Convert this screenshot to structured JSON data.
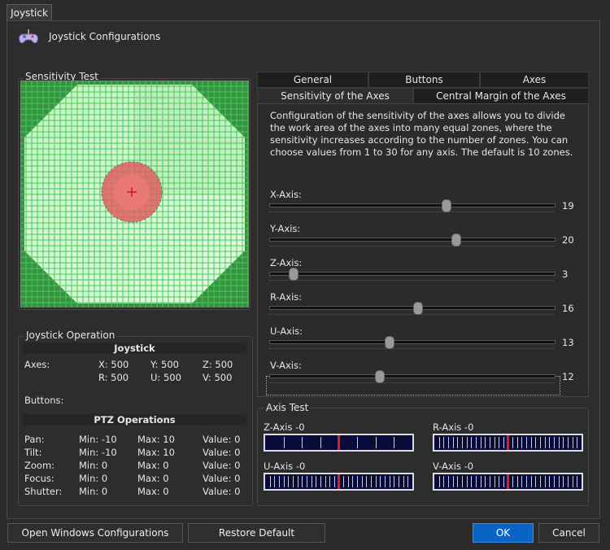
{
  "tab_title": "Joystick",
  "dialog_title": "Joystick Configurations",
  "sensitivity_test_label": "Sensitivity Test",
  "tabs": {
    "row1": [
      "General",
      "Buttons",
      "Axes"
    ],
    "row2": [
      "Sensitivity of the Axes",
      "Central Margin of the Axes"
    ],
    "active": "Sensitivity of the Axes"
  },
  "description": "Configuration of the sensitivity of the axes allows you to divide the work area of the axes into many equal zones, where the sensitivity increases according to the number of zones. You can choose values from 1 to 30 for any axis. The default is 10 zones.",
  "sliders": [
    {
      "label": "X-Axis:",
      "value": "19"
    },
    {
      "label": "Y-Axis:",
      "value": "20"
    },
    {
      "label": "Z-Axis:",
      "value": "3"
    },
    {
      "label": "R-Axis:",
      "value": "16"
    },
    {
      "label": "U-Axis:",
      "value": "13"
    },
    {
      "label": "V-Axis:",
      "value": "12"
    }
  ],
  "joystick_operation": {
    "legend": "Joystick Operation",
    "header": "Joystick",
    "axes_label": "Axes:",
    "axes": [
      "X: 500",
      "Y: 500",
      "Z: 500",
      "R: 500",
      "U: 500",
      "V: 500"
    ],
    "buttons_label": "Buttons:",
    "ptz_header": "PTZ Operations",
    "ptz_rows": [
      {
        "name": "Pan:",
        "min": "Min: -10",
        "max": "Max: 10",
        "value": "Value: 0"
      },
      {
        "name": "Tilt:",
        "min": "Min: -10",
        "max": "Max: 10",
        "value": "Value: 0"
      },
      {
        "name": "Zoom:",
        "min": "Min: 0",
        "max": "Max: 0",
        "value": "Value: 0"
      },
      {
        "name": "Focus:",
        "min": "Min: 0",
        "max": "Max: 0",
        "value": "Value: 0"
      },
      {
        "name": "Shutter:",
        "min": "Min: 0",
        "max": "Max: 0",
        "value": "Value: 0"
      }
    ]
  },
  "axis_test": {
    "legend": "Axis Test",
    "items": [
      {
        "label": "Z-Axis -0"
      },
      {
        "label": "R-Axis -0"
      },
      {
        "label": "U-Axis -0"
      },
      {
        "label": "V-Axis -0"
      }
    ]
  },
  "buttons": {
    "open_windows": "Open Windows Configurations",
    "restore_default": "Restore Default",
    "ok": "OK",
    "cancel": "Cancel"
  },
  "colors": {
    "accent": "#0a64c6",
    "grid_green": "#2f8f3a",
    "meter_bg": "#0a0a3a",
    "meter_marker": "#e02020"
  }
}
